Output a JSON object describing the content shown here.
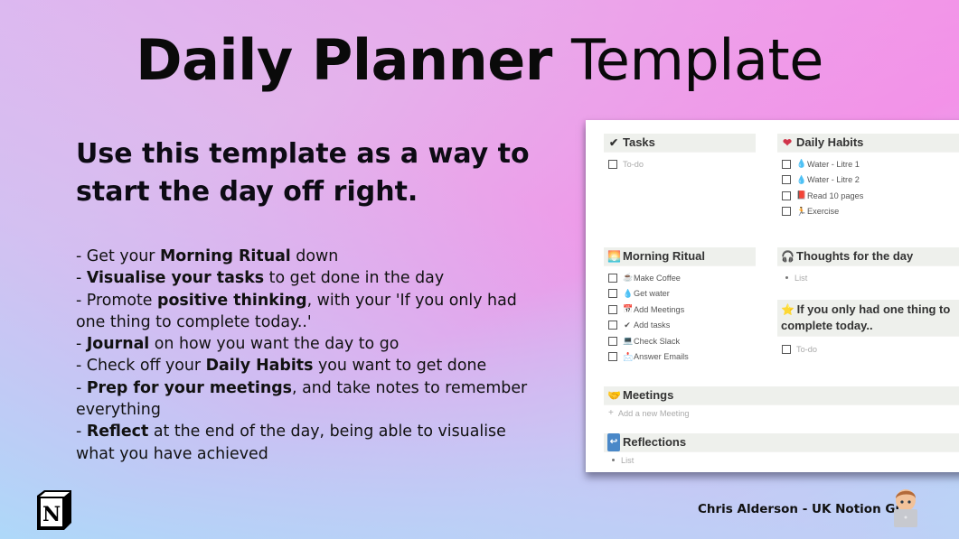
{
  "header": {
    "title_bold": "Daily Planner",
    "title_light": "Template"
  },
  "subtitle": "Use this template as a way to start the day off right.",
  "features": [
    {
      "pre": "- Get your ",
      "bold": "Morning Ritual",
      "post": " down"
    },
    {
      "pre": "- ",
      "bold": "Visualise your tasks",
      "post": " to get done in the day"
    },
    {
      "pre": "- Promote ",
      "bold": "positive thinking",
      "post": ", with your 'If you only had one thing to complete today..'"
    },
    {
      "pre": "- ",
      "bold": "Journal",
      "post": " on how you want the day to go"
    },
    {
      "pre": "- Check off your ",
      "bold": "Daily Habits",
      "post": " you want to get done"
    },
    {
      "pre": "- ",
      "bold": "Prep for your meetings",
      "post": ", and take notes to remember everything"
    },
    {
      "pre": "- ",
      "bold": "Reflect",
      "post": " at the end of the day, being able to visualise what you have achieved"
    }
  ],
  "panel": {
    "tasks": {
      "icon": "check-mark-icon",
      "emoji": "✔",
      "title": "Tasks",
      "items": [
        {
          "label": "To-do",
          "placeholder": true
        }
      ]
    },
    "daily_habits": {
      "icon": "heart-icon",
      "emoji": "❤",
      "title": "Daily Habits",
      "items": [
        {
          "emoji": "💧",
          "icon": "droplet-icon",
          "label": "Water - Litre 1"
        },
        {
          "emoji": "💧",
          "icon": "droplet-icon",
          "label": "Water - Litre 2"
        },
        {
          "emoji": "📕",
          "icon": "book-icon",
          "label": "Read 10 pages"
        },
        {
          "emoji": "🏃",
          "icon": "runner-icon",
          "label": "Exercise"
        }
      ]
    },
    "morning_ritual": {
      "icon": "sunrise-icon",
      "emoji": "🌅",
      "title": "Morning Ritual",
      "items": [
        {
          "emoji": "☕",
          "icon": "coffee-icon",
          "label": "Make Coffee"
        },
        {
          "emoji": "💧",
          "icon": "droplet-icon",
          "label": "Get water"
        },
        {
          "emoji": "📅",
          "icon": "calendar-icon",
          "label": "Add Meetings"
        },
        {
          "emoji": "✔",
          "icon": "check-mark-icon",
          "label": "Add tasks"
        },
        {
          "emoji": "💻",
          "icon": "laptop-icon",
          "label": "Check Slack"
        },
        {
          "emoji": "📩",
          "icon": "envelope-icon",
          "label": "Answer Emails"
        }
      ]
    },
    "thoughts": {
      "icon": "headphones-icon",
      "emoji": "🎧",
      "title": "Thoughts for the day",
      "items": [
        {
          "label": "List",
          "placeholder": true
        }
      ]
    },
    "one_thing": {
      "icon": "star-icon",
      "emoji": "⭐",
      "title": "If you only had one thing to complete today..",
      "items": [
        {
          "label": "To-do",
          "placeholder": true
        }
      ]
    },
    "meetings": {
      "icon": "handshake-icon",
      "emoji": "🤝",
      "title": "Meetings",
      "add_label": "Add a new Meeting"
    },
    "reflections": {
      "icon": "return-arrow-icon",
      "emoji": "↩",
      "title": "Reflections",
      "items": [
        {
          "label": "List",
          "placeholder": true
        }
      ]
    }
  },
  "footer": {
    "author": "Chris Alderson - UK Notion Guy",
    "logo": "notion-logo-icon"
  }
}
